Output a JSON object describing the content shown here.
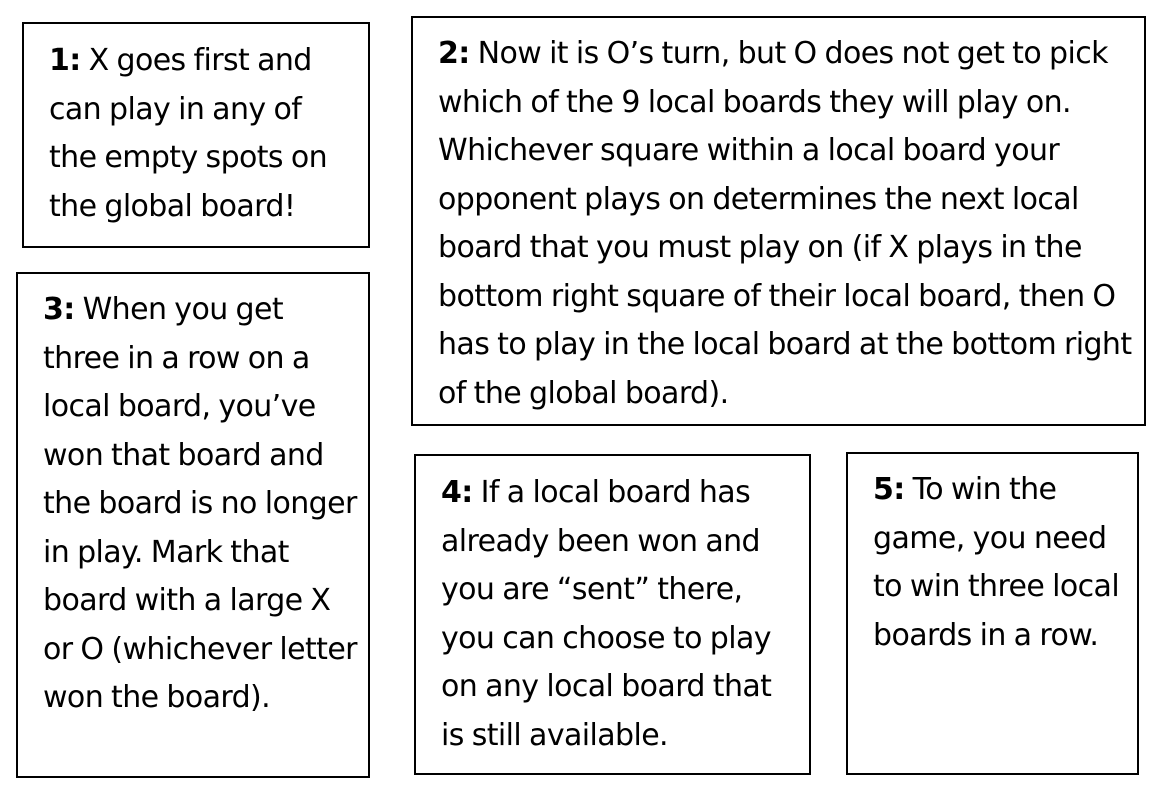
{
  "rules": [
    {
      "number": "1:",
      "text": " X goes first and can play in any of the empty spots on the global board!"
    },
    {
      "number": "2:",
      "text": " Now it is O’s turn, but O does not get to pick which of the 9 local boards they will play on. Whichever square within a local board your opponent plays on determines the next local board that you must play on (if X plays in the bottom right square of their local board, then O has to play in the local board at the bottom right of the global board)."
    },
    {
      "number": "3:",
      "text": " When you get three in a row on a local board, you’ve won that board and the board is no longer in play. Mark that board with a large X or O (whichever letter won the board)."
    },
    {
      "number": "4:",
      "text": " If a local board has already been won and you are “sent” there, you can choose to play on any local board that is still available."
    },
    {
      "number": "5:",
      "text": " To win the game, you need to win three local boards in a row."
    }
  ]
}
